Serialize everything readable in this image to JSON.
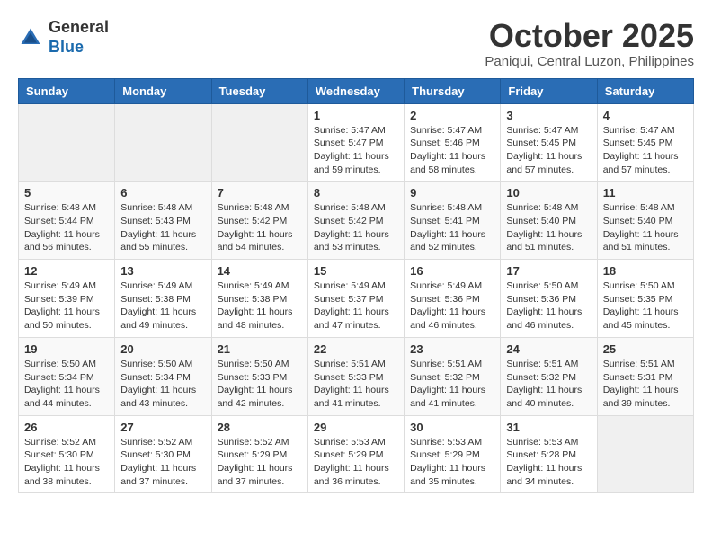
{
  "header": {
    "logo_general": "General",
    "logo_blue": "Blue",
    "month_title": "October 2025",
    "location": "Paniqui, Central Luzon, Philippines"
  },
  "weekdays": [
    "Sunday",
    "Monday",
    "Tuesday",
    "Wednesday",
    "Thursday",
    "Friday",
    "Saturday"
  ],
  "weeks": [
    [
      {
        "day": "",
        "info": ""
      },
      {
        "day": "",
        "info": ""
      },
      {
        "day": "",
        "info": ""
      },
      {
        "day": "1",
        "info": "Sunrise: 5:47 AM\nSunset: 5:47 PM\nDaylight: 11 hours\nand 59 minutes."
      },
      {
        "day": "2",
        "info": "Sunrise: 5:47 AM\nSunset: 5:46 PM\nDaylight: 11 hours\nand 58 minutes."
      },
      {
        "day": "3",
        "info": "Sunrise: 5:47 AM\nSunset: 5:45 PM\nDaylight: 11 hours\nand 57 minutes."
      },
      {
        "day": "4",
        "info": "Sunrise: 5:47 AM\nSunset: 5:45 PM\nDaylight: 11 hours\nand 57 minutes."
      }
    ],
    [
      {
        "day": "5",
        "info": "Sunrise: 5:48 AM\nSunset: 5:44 PM\nDaylight: 11 hours\nand 56 minutes."
      },
      {
        "day": "6",
        "info": "Sunrise: 5:48 AM\nSunset: 5:43 PM\nDaylight: 11 hours\nand 55 minutes."
      },
      {
        "day": "7",
        "info": "Sunrise: 5:48 AM\nSunset: 5:42 PM\nDaylight: 11 hours\nand 54 minutes."
      },
      {
        "day": "8",
        "info": "Sunrise: 5:48 AM\nSunset: 5:42 PM\nDaylight: 11 hours\nand 53 minutes."
      },
      {
        "day": "9",
        "info": "Sunrise: 5:48 AM\nSunset: 5:41 PM\nDaylight: 11 hours\nand 52 minutes."
      },
      {
        "day": "10",
        "info": "Sunrise: 5:48 AM\nSunset: 5:40 PM\nDaylight: 11 hours\nand 51 minutes."
      },
      {
        "day": "11",
        "info": "Sunrise: 5:48 AM\nSunset: 5:40 PM\nDaylight: 11 hours\nand 51 minutes."
      }
    ],
    [
      {
        "day": "12",
        "info": "Sunrise: 5:49 AM\nSunset: 5:39 PM\nDaylight: 11 hours\nand 50 minutes."
      },
      {
        "day": "13",
        "info": "Sunrise: 5:49 AM\nSunset: 5:38 PM\nDaylight: 11 hours\nand 49 minutes."
      },
      {
        "day": "14",
        "info": "Sunrise: 5:49 AM\nSunset: 5:38 PM\nDaylight: 11 hours\nand 48 minutes."
      },
      {
        "day": "15",
        "info": "Sunrise: 5:49 AM\nSunset: 5:37 PM\nDaylight: 11 hours\nand 47 minutes."
      },
      {
        "day": "16",
        "info": "Sunrise: 5:49 AM\nSunset: 5:36 PM\nDaylight: 11 hours\nand 46 minutes."
      },
      {
        "day": "17",
        "info": "Sunrise: 5:50 AM\nSunset: 5:36 PM\nDaylight: 11 hours\nand 46 minutes."
      },
      {
        "day": "18",
        "info": "Sunrise: 5:50 AM\nSunset: 5:35 PM\nDaylight: 11 hours\nand 45 minutes."
      }
    ],
    [
      {
        "day": "19",
        "info": "Sunrise: 5:50 AM\nSunset: 5:34 PM\nDaylight: 11 hours\nand 44 minutes."
      },
      {
        "day": "20",
        "info": "Sunrise: 5:50 AM\nSunset: 5:34 PM\nDaylight: 11 hours\nand 43 minutes."
      },
      {
        "day": "21",
        "info": "Sunrise: 5:50 AM\nSunset: 5:33 PM\nDaylight: 11 hours\nand 42 minutes."
      },
      {
        "day": "22",
        "info": "Sunrise: 5:51 AM\nSunset: 5:33 PM\nDaylight: 11 hours\nand 41 minutes."
      },
      {
        "day": "23",
        "info": "Sunrise: 5:51 AM\nSunset: 5:32 PM\nDaylight: 11 hours\nand 41 minutes."
      },
      {
        "day": "24",
        "info": "Sunrise: 5:51 AM\nSunset: 5:32 PM\nDaylight: 11 hours\nand 40 minutes."
      },
      {
        "day": "25",
        "info": "Sunrise: 5:51 AM\nSunset: 5:31 PM\nDaylight: 11 hours\nand 39 minutes."
      }
    ],
    [
      {
        "day": "26",
        "info": "Sunrise: 5:52 AM\nSunset: 5:30 PM\nDaylight: 11 hours\nand 38 minutes."
      },
      {
        "day": "27",
        "info": "Sunrise: 5:52 AM\nSunset: 5:30 PM\nDaylight: 11 hours\nand 37 minutes."
      },
      {
        "day": "28",
        "info": "Sunrise: 5:52 AM\nSunset: 5:29 PM\nDaylight: 11 hours\nand 37 minutes."
      },
      {
        "day": "29",
        "info": "Sunrise: 5:53 AM\nSunset: 5:29 PM\nDaylight: 11 hours\nand 36 minutes."
      },
      {
        "day": "30",
        "info": "Sunrise: 5:53 AM\nSunset: 5:29 PM\nDaylight: 11 hours\nand 35 minutes."
      },
      {
        "day": "31",
        "info": "Sunrise: 5:53 AM\nSunset: 5:28 PM\nDaylight: 11 hours\nand 34 minutes."
      },
      {
        "day": "",
        "info": ""
      }
    ]
  ]
}
